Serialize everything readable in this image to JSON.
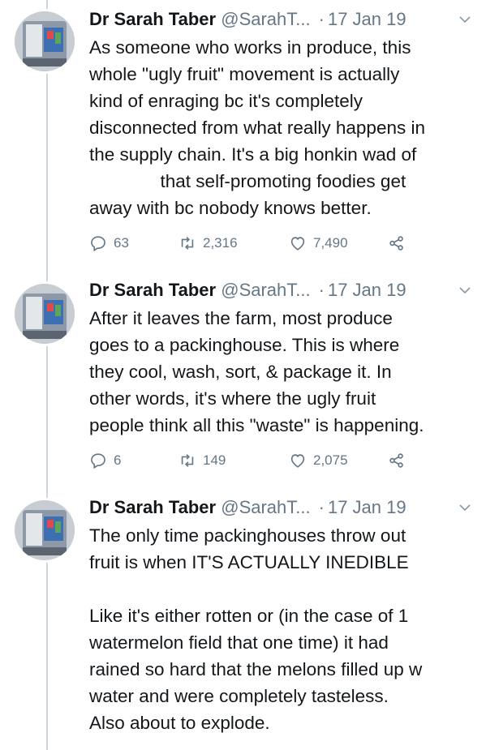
{
  "tweets": [
    {
      "name": "Dr Sarah Taber",
      "handle": "@SarahT...",
      "date": "17 Jan 19",
      "text": "As someone who works in produce, this\nwhole \"ugly fruit\" movement is actually\nkind of enraging bc it's completely\ndisconnected from what really happens in\nthe supply chain. It's a big honkin wad of\n              that self-promoting foodies get\naway with bc nobody knows better.",
      "replies": "63",
      "retweets": "2,316",
      "likes": "7,490"
    },
    {
      "name": "Dr Sarah Taber",
      "handle": "@SarahT...",
      "date": "17 Jan 19",
      "text": "After it leaves the farm, most produce\ngoes to a packinghouse. This is where\nthey cool, wash, sort, & package it. In\nother words, it's where the ugly fruit\npeople think all this \"waste\" is happening.",
      "replies": "6",
      "retweets": "149",
      "likes": "2,075"
    },
    {
      "name": "Dr Sarah Taber",
      "handle": "@SarahT...",
      "date": "17 Jan 19",
      "text": "The only time packinghouses throw out\nfruit is when IT'S ACTUALLY INEDIBLE\n\nLike it's either rotten or (in the case of 1\nwatermelon field that one time) it had\nrained so hard that the melons filled up w\nwater and were completely tasteless.\nAlso about to explode."
    }
  ],
  "icons": {
    "reply": "reply-icon",
    "retweet": "retweet-icon",
    "like": "heart-icon",
    "share": "share-icon",
    "menu": "chevron-down-icon"
  },
  "colors": {
    "text": "#14171a",
    "secondary": "#657786",
    "thread_line": "#ccd6dd"
  }
}
